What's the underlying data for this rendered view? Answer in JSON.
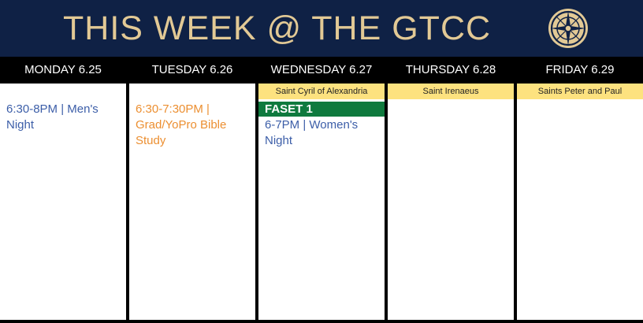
{
  "header": {
    "title": "THIS WEEK @ THE GTCC"
  },
  "days": [
    {
      "label": "MONDAY 6.25",
      "events": [
        {
          "text": "6:30-8PM | Men's Night"
        }
      ]
    },
    {
      "label": "TUESDAY 6.26",
      "events": [
        {
          "text": "6:30-7:30PM | Grad/YoPro Bible Study"
        }
      ]
    },
    {
      "label": "WEDNESDAY 6.27",
      "feast": "Saint Cyril of Alexandria",
      "highlight": "FASET 1",
      "events": [
        {
          "text": "6-7PM | Women's Night"
        }
      ]
    },
    {
      "label": "THURSDAY 6.28",
      "feast": "Saint Irenaeus"
    },
    {
      "label": "FRIDAY 6.29",
      "feast": "Saints Peter and Paul"
    }
  ],
  "colors": {
    "header_bg": "#0f2145",
    "title_gold": "#e2c995",
    "feast_bg": "#fde27f",
    "event_blue": "#3c5ea8",
    "event_orange": "#ec8f31",
    "highlight_green": "#0f7a3e"
  },
  "icons": {
    "logo": "compass-rose-icon"
  }
}
